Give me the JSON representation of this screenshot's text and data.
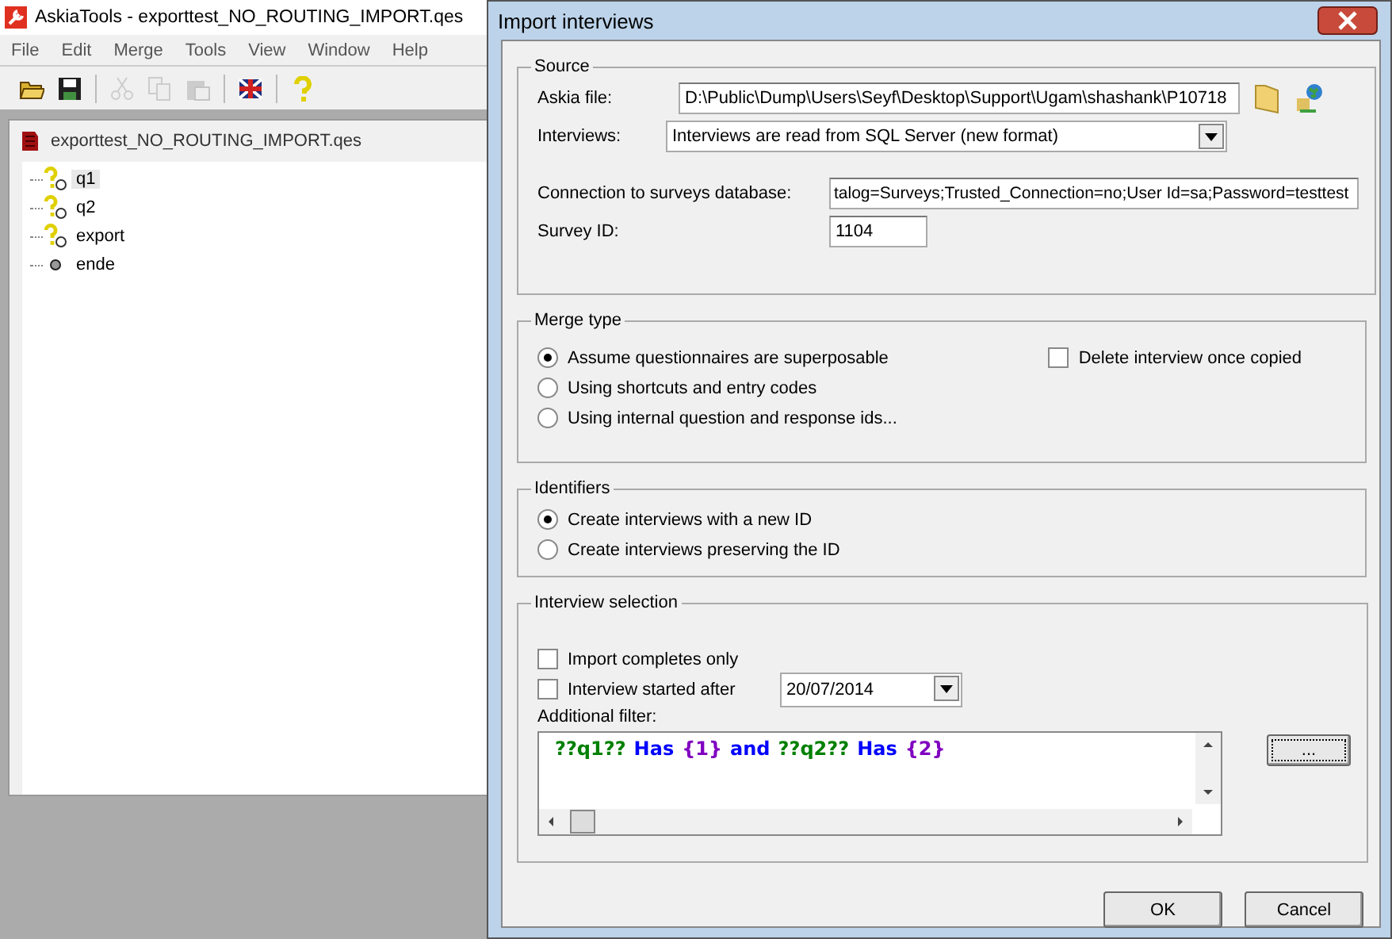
{
  "app": {
    "title": "AskiaTools - exporttest_NO_ROUTING_IMPORT.qes",
    "menu": [
      "File",
      "Edit",
      "Merge",
      "Tools",
      "View",
      "Window",
      "Help"
    ],
    "toolbar": [
      {
        "kind": "open",
        "disabled": false
      },
      {
        "kind": "save",
        "disabled": false
      },
      {
        "kind": "cut",
        "disabled": true
      },
      {
        "kind": "copy",
        "disabled": true
      },
      {
        "kind": "paste",
        "disabled": true
      },
      {
        "kind": "flag",
        "disabled": false
      },
      {
        "kind": "help",
        "disabled": false
      }
    ],
    "document": {
      "title": "exporttest_NO_ROUTING_IMPORT.qes",
      "tree": [
        {
          "label": "q1",
          "kind": "question",
          "selected": true
        },
        {
          "label": "q2",
          "kind": "question",
          "selected": false
        },
        {
          "label": "export",
          "kind": "question",
          "selected": false
        },
        {
          "label": "ende",
          "kind": "end",
          "selected": false
        }
      ]
    }
  },
  "dialog": {
    "title": "Import interviews",
    "source": {
      "legend": "Source",
      "askia_file": {
        "label": "Askia file:",
        "value": "D:\\Public\\Dump\\Users\\Seyf\\Desktop\\Support\\Ugam\\shashank\\P10718"
      },
      "interviews": {
        "label": "Interviews:",
        "value": "Interviews are read from SQL Server (new format)"
      },
      "connection": {
        "label": "Connection to surveys database:",
        "value": "talog=Surveys;Trusted_Connection=no;User Id=sa;Password=testtest"
      },
      "survey_id": {
        "label": "Survey ID:",
        "value": "1104"
      }
    },
    "merge_type": {
      "legend": "Merge type",
      "options": [
        {
          "label": "Assume questionnaires are superposable",
          "selected": true
        },
        {
          "label": "Using shortcuts and entry codes",
          "selected": false
        },
        {
          "label": "Using internal question and response ids...",
          "selected": false
        }
      ],
      "delete_once_copied": {
        "label": "Delete interview once copied",
        "checked": false
      }
    },
    "identifiers": {
      "legend": "Identifiers",
      "options": [
        {
          "label": "Create interviews with a new ID",
          "selected": true
        },
        {
          "label": "Create interviews preserving the ID",
          "selected": false
        }
      ]
    },
    "interview_selection": {
      "legend": "Interview selection",
      "import_completes_only": {
        "label": "Import completes only",
        "checked": false
      },
      "started_after": {
        "label": "Interview started after",
        "checked": false,
        "date": "20/07/2014"
      },
      "filter_label": "Additional filter:",
      "filter_tokens": [
        {
          "text": "??q1??",
          "color": "#008000"
        },
        {
          "text": "Has",
          "color": "#0000ff"
        },
        {
          "text": "{1}",
          "color": "#8000c0"
        },
        {
          "text": "and",
          "color": "#0000ff"
        },
        {
          "text": "??q2??",
          "color": "#008000"
        },
        {
          "text": "Has",
          "color": "#0000ff"
        },
        {
          "text": "{2}",
          "color": "#8000c0"
        }
      ],
      "browse_button": "..."
    },
    "buttons": [
      "OK",
      "Cancel"
    ]
  }
}
